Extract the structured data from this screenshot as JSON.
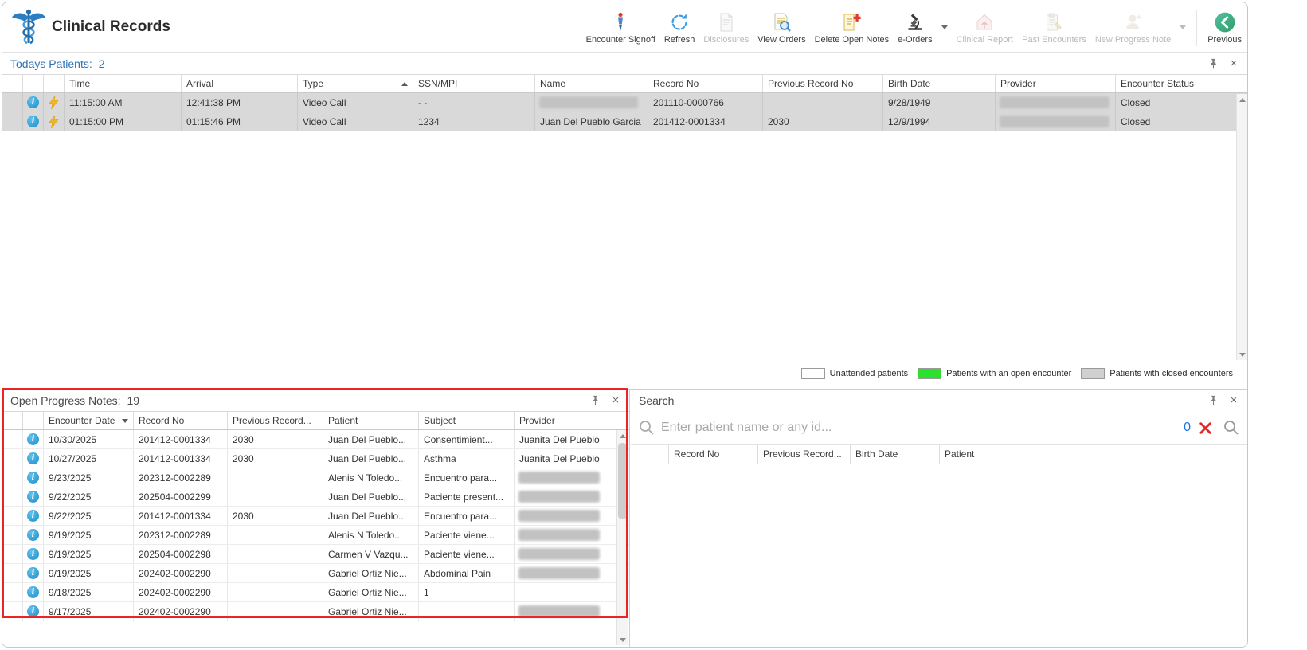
{
  "colors": {
    "accent_blue": "#2e74b5",
    "open_encounter_green": "#2ee02e",
    "closed_encounter_gray": "#d0d0d0",
    "annotation_red": "#ec2423",
    "info_icon_blue": "#1b8ccb"
  },
  "header": {
    "app_title": "Clinical Records",
    "toolbar": [
      {
        "label": "Encounter Signoff",
        "enabled": true
      },
      {
        "label": "Refresh",
        "enabled": true
      },
      {
        "label": "Disclosures",
        "enabled": false
      },
      {
        "label": "View Orders",
        "enabled": true
      },
      {
        "label": "Delete Open Notes",
        "enabled": true
      },
      {
        "label": "e-Orders",
        "enabled": true,
        "has_dropdown": true
      },
      {
        "label": "Clinical Report",
        "enabled": false
      },
      {
        "label": "Past Encounters",
        "enabled": false
      },
      {
        "label": "New Progress Note",
        "enabled": false,
        "has_dropdown": true
      },
      {
        "label": "Previous",
        "enabled": true
      }
    ]
  },
  "todays_patients": {
    "title": "Todays Patients:",
    "count": "2",
    "sorted_by": "Type",
    "sort_direction": "ascending",
    "columns": {
      "time": "Time",
      "arrival": "Arrival",
      "type": "Type",
      "ssn_mpi": "SSN/MPI",
      "name": "Name",
      "record_no": "Record No",
      "previous_record_no": "Previous Record No",
      "birth_date": "Birth Date",
      "provider": "Provider",
      "encounter_status": "Encounter Status"
    },
    "rows": [
      {
        "time": "11:15:00 AM",
        "arrival": "12:41:38 PM",
        "type": "Video Call",
        "ssn_mpi": "-  -",
        "name": "",
        "name_redacted": true,
        "record_no": "201110-0000766",
        "previous_record_no": "",
        "birth_date": "9/28/1949",
        "provider": "",
        "provider_redacted": true,
        "encounter_status": "Closed"
      },
      {
        "time": "01:15:00 PM",
        "arrival": "01:15:46 PM",
        "type": "Video Call",
        "ssn_mpi": "1234",
        "name": "Juan Del Pueblo Garcia",
        "name_redacted": false,
        "record_no": "201412-0001334",
        "previous_record_no": "2030",
        "birth_date": "12/9/1994",
        "provider": "",
        "provider_redacted": true,
        "encounter_status": "Closed"
      }
    ],
    "legend": [
      {
        "label": "Unattended patients",
        "color": "#ffffff"
      },
      {
        "label": "Patients with an open encounter",
        "color": "#2ee02e"
      },
      {
        "label": "Patients with closed encounters",
        "color": "#d0d0d0"
      }
    ]
  },
  "open_progress_notes": {
    "title": "Open Progress Notes:",
    "count": "19",
    "sorted_by": "Encounter Date",
    "sort_direction": "descending",
    "columns": {
      "encounter_date": "Encounter Date",
      "record_no": "Record No",
      "previous_record": "Previous Record...",
      "patient": "Patient",
      "subject": "Subject",
      "provider": "Provider"
    },
    "rows": [
      {
        "encounter_date": "10/30/2025",
        "record_no": "201412-0001334",
        "previous_record": "2030",
        "patient": "Juan Del Pueblo...",
        "subject": "Consentimient...",
        "provider": "Juanita Del Pueblo",
        "provider_redacted": false
      },
      {
        "encounter_date": "10/27/2025",
        "record_no": "201412-0001334",
        "previous_record": "2030",
        "patient": "Juan Del Pueblo...",
        "subject": "Asthma",
        "provider": "Juanita Del Pueblo",
        "provider_redacted": false
      },
      {
        "encounter_date": "9/23/2025",
        "record_no": "202312-0002289",
        "previous_record": "",
        "patient": "Alenis N Toledo...",
        "subject": "Encuentro para...",
        "provider": "",
        "provider_redacted": true
      },
      {
        "encounter_date": "9/22/2025",
        "record_no": "202504-0002299",
        "previous_record": "",
        "patient": "Juan Del Pueblo...",
        "subject": "Paciente present...",
        "provider": "",
        "provider_redacted": true
      },
      {
        "encounter_date": "9/22/2025",
        "record_no": "201412-0001334",
        "previous_record": "2030",
        "patient": "Juan Del Pueblo...",
        "subject": "Encuentro para...",
        "provider": "",
        "provider_redacted": true
      },
      {
        "encounter_date": "9/19/2025",
        "record_no": "202312-0002289",
        "previous_record": "",
        "patient": "Alenis N Toledo...",
        "subject": "Paciente viene...",
        "provider": "",
        "provider_redacted": true
      },
      {
        "encounter_date": "9/19/2025",
        "record_no": "202504-0002298",
        "previous_record": "",
        "patient": "Carmen V Vazqu...",
        "subject": "Paciente viene...",
        "provider": "",
        "provider_redacted": true
      },
      {
        "encounter_date": "9/19/2025",
        "record_no": "202402-0002290",
        "previous_record": "",
        "patient": "Gabriel Ortiz Nie...",
        "subject": "Abdominal Pain",
        "provider": "",
        "provider_redacted": true
      },
      {
        "encounter_date": "9/18/2025",
        "record_no": "202402-0002290",
        "previous_record": "",
        "patient": "Gabriel Ortiz Nie...",
        "subject": "1",
        "provider": "",
        "provider_redacted": false
      },
      {
        "encounter_date": "9/17/2025",
        "record_no": "202402-0002290",
        "previous_record": "",
        "patient": "Gabriel Ortiz Nie...",
        "subject": "",
        "provider": "",
        "provider_redacted": true
      }
    ]
  },
  "search": {
    "title": "Search",
    "input_placeholder": "Enter patient name or any id...",
    "input_value": "",
    "result_count": "0",
    "columns": {
      "record_no": "Record No",
      "previous_record": "Previous Record...",
      "birth_date": "Birth Date",
      "patient": "Patient"
    }
  },
  "annotation": {
    "shape": "rectangle",
    "color": "#ec2423",
    "target": "open-progress-notes-panel"
  }
}
